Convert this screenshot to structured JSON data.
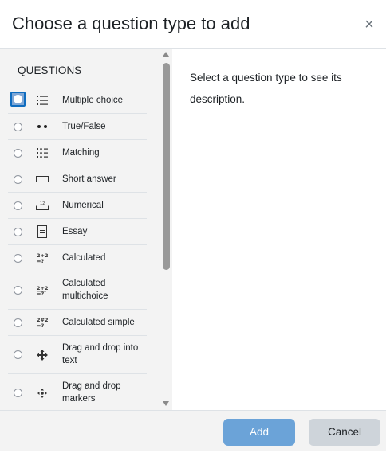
{
  "dialog": {
    "title": "Choose a question type to add",
    "close_glyph": "×"
  },
  "options": {
    "section_label": "QUESTIONS",
    "items": [
      {
        "label": "Multiple choice",
        "icon": "list-icon",
        "selected": true
      },
      {
        "label": "True/False",
        "icon": "two-dots-icon",
        "selected": false
      },
      {
        "label": "Matching",
        "icon": "matching-list-icon",
        "selected": false
      },
      {
        "label": "Short answer",
        "icon": "short-answer-box-icon",
        "selected": false
      },
      {
        "label": "Numerical",
        "icon": "numerical-icon",
        "selected": false
      },
      {
        "label": "Essay",
        "icon": "essay-document-icon",
        "selected": false
      },
      {
        "label": "Calculated",
        "icon": "calculated-icon",
        "selected": false
      },
      {
        "label": "Calculated multichoice",
        "icon": "calculated-multichoice-icon",
        "selected": false
      },
      {
        "label": "Calculated simple",
        "icon": "calculated-simple-icon",
        "selected": false
      },
      {
        "label": "Drag and drop into text",
        "icon": "drag-drop-text-icon",
        "selected": false
      },
      {
        "label": "Drag and drop markers",
        "icon": "drag-drop-markers-icon",
        "selected": false
      }
    ]
  },
  "description": {
    "placeholder": "Select a question type to see its description."
  },
  "footer": {
    "add_label": "Add",
    "cancel_label": "Cancel"
  },
  "colors": {
    "primary_button": "#6ba3d8",
    "secondary_button": "#ced4da",
    "focus_ring": "#0f6cbf",
    "pane_background": "#f3f3f3"
  }
}
